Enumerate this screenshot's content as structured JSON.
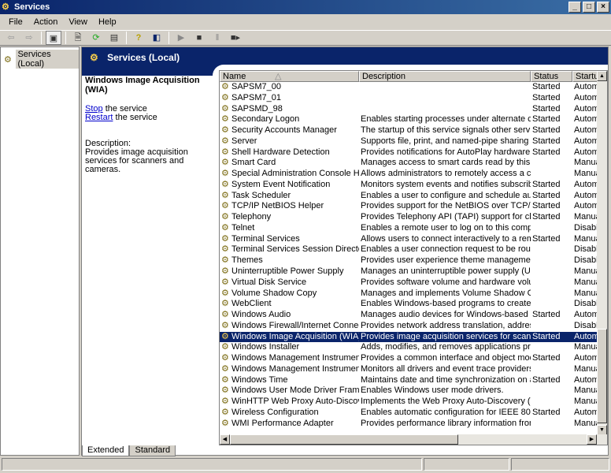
{
  "window": {
    "title": "Services",
    "controls": [
      "_",
      "□",
      "×"
    ]
  },
  "menu": [
    "File",
    "Action",
    "View",
    "Help"
  ],
  "toolbar": {
    "icons": [
      "back-icon",
      "forward-icon",
      "show-hide-tree-icon",
      "properties-icon",
      "refresh-icon",
      "export-list-icon",
      "help-icon",
      "show-hide-action-pane-icon",
      "start-icon",
      "stop-icon",
      "pause-icon",
      "restart-icon"
    ]
  },
  "tree": {
    "root": "Services (Local)"
  },
  "banner": {
    "title": "Services (Local)"
  },
  "detail": {
    "service_name": "Windows Image Acquisition (WIA)",
    "stop_link": "Stop",
    "stop_suffix": " the service",
    "restart_link": "Restart",
    "restart_suffix": " the service",
    "description_label": "Description:",
    "description": "Provides image acquisition services for scanners and cameras."
  },
  "list": {
    "columns": [
      "Name",
      "Description",
      "Status",
      "Startup"
    ],
    "sort_indicator": "△",
    "selected_index": 23,
    "rows": [
      [
        "SAPSM7_00",
        "",
        "Started",
        "Automa"
      ],
      [
        "SAPSM7_01",
        "",
        "Started",
        "Automa"
      ],
      [
        "SAPSMD_98",
        "",
        "Started",
        "Automa"
      ],
      [
        "Secondary Logon",
        "Enables starting processes under alternate creden...",
        "Started",
        "Automa"
      ],
      [
        "Security Accounts Manager",
        "The startup of this service signals other services th...",
        "Started",
        "Automa"
      ],
      [
        "Server",
        "Supports file, print, and named-pipe sharing over t...",
        "Started",
        "Automa"
      ],
      [
        "Shell Hardware Detection",
        "Provides notifications for AutoPlay hardware events.",
        "Started",
        "Automa"
      ],
      [
        "Smart Card",
        "Manages access to smart cards read by this compu...",
        "",
        "Manual"
      ],
      [
        "Special Administration Console Helper",
        "Allows administrators to remotely access a comman...",
        "",
        "Manual"
      ],
      [
        "System Event Notification",
        "Monitors system events and notifies subscribers to...",
        "Started",
        "Automa"
      ],
      [
        "Task Scheduler",
        "Enables a user to configure and schedule automat...",
        "Started",
        "Automa"
      ],
      [
        "TCP/IP NetBIOS Helper",
        "Provides support for the NetBIOS over TCP/IP (Ne...",
        "Started",
        "Automa"
      ],
      [
        "Telephony",
        "Provides Telephony API (TAPI) support for clients ...",
        "Started",
        "Manual"
      ],
      [
        "Telnet",
        "Enables a remote user to log on to this computer a...",
        "",
        "Disable"
      ],
      [
        "Terminal Services",
        "Allows users to connect interactively to a remote c...",
        "Started",
        "Manual"
      ],
      [
        "Terminal Services Session Directory",
        "Enables a user connection request to be routed to ...",
        "",
        "Disable"
      ],
      [
        "Themes",
        "Provides user experience theme management.",
        "",
        "Disable"
      ],
      [
        "Uninterruptible Power Supply",
        "Manages an uninterruptible power supply (UPS) co...",
        "",
        "Manual"
      ],
      [
        "Virtual Disk Service",
        "Provides software volume and hardware volume m...",
        "",
        "Manual"
      ],
      [
        "Volume Shadow Copy",
        "Manages and implements Volume Shadow Copies u...",
        "",
        "Manual"
      ],
      [
        "WebClient",
        "Enables Windows-based programs to create, acces...",
        "",
        "Disable"
      ],
      [
        "Windows Audio",
        "Manages audio devices for Windows-based progra...",
        "Started",
        "Automa"
      ],
      [
        "Windows Firewall/Internet Connection...",
        "Provides network address translation, addressing, ...",
        "",
        "Disable"
      ],
      [
        "Windows Image Acquisition (WIA)",
        "Provides image acquisition services for scanners an...",
        "Started",
        "Automa"
      ],
      [
        "Windows Installer",
        "Adds, modifies, and removes applications provided...",
        "",
        "Manual"
      ],
      [
        "Windows Management Instrumentation",
        "Provides a common interface and object model to a...",
        "Started",
        "Automa"
      ],
      [
        "Windows Management Instrumentatio...",
        "Monitors all drivers and event trace providers that ...",
        "",
        "Manual"
      ],
      [
        "Windows Time",
        "Maintains date and time synchronization on all clien...",
        "Started",
        "Automa"
      ],
      [
        "Windows User Mode Driver Framework",
        "Enables Windows user mode drivers.",
        "",
        "Manual"
      ],
      [
        "WinHTTP Web Proxy Auto-Discovery S...",
        "Implements the Web Proxy Auto-Discovery (WPAD...",
        "",
        "Manual"
      ],
      [
        "Wireless Configuration",
        "Enables automatic configuration for IEEE 802.11 a...",
        "Started",
        "Automa"
      ],
      [
        "WMI Performance Adapter",
        "Provides performance library information from Win...",
        "",
        "Manual"
      ]
    ]
  },
  "tabs": [
    "Extended",
    "Standard"
  ],
  "colors": {
    "title_bar": "#0a246a",
    "selection": "#0a246a",
    "link": "#0000cc",
    "chrome": "#d4d0c8"
  }
}
